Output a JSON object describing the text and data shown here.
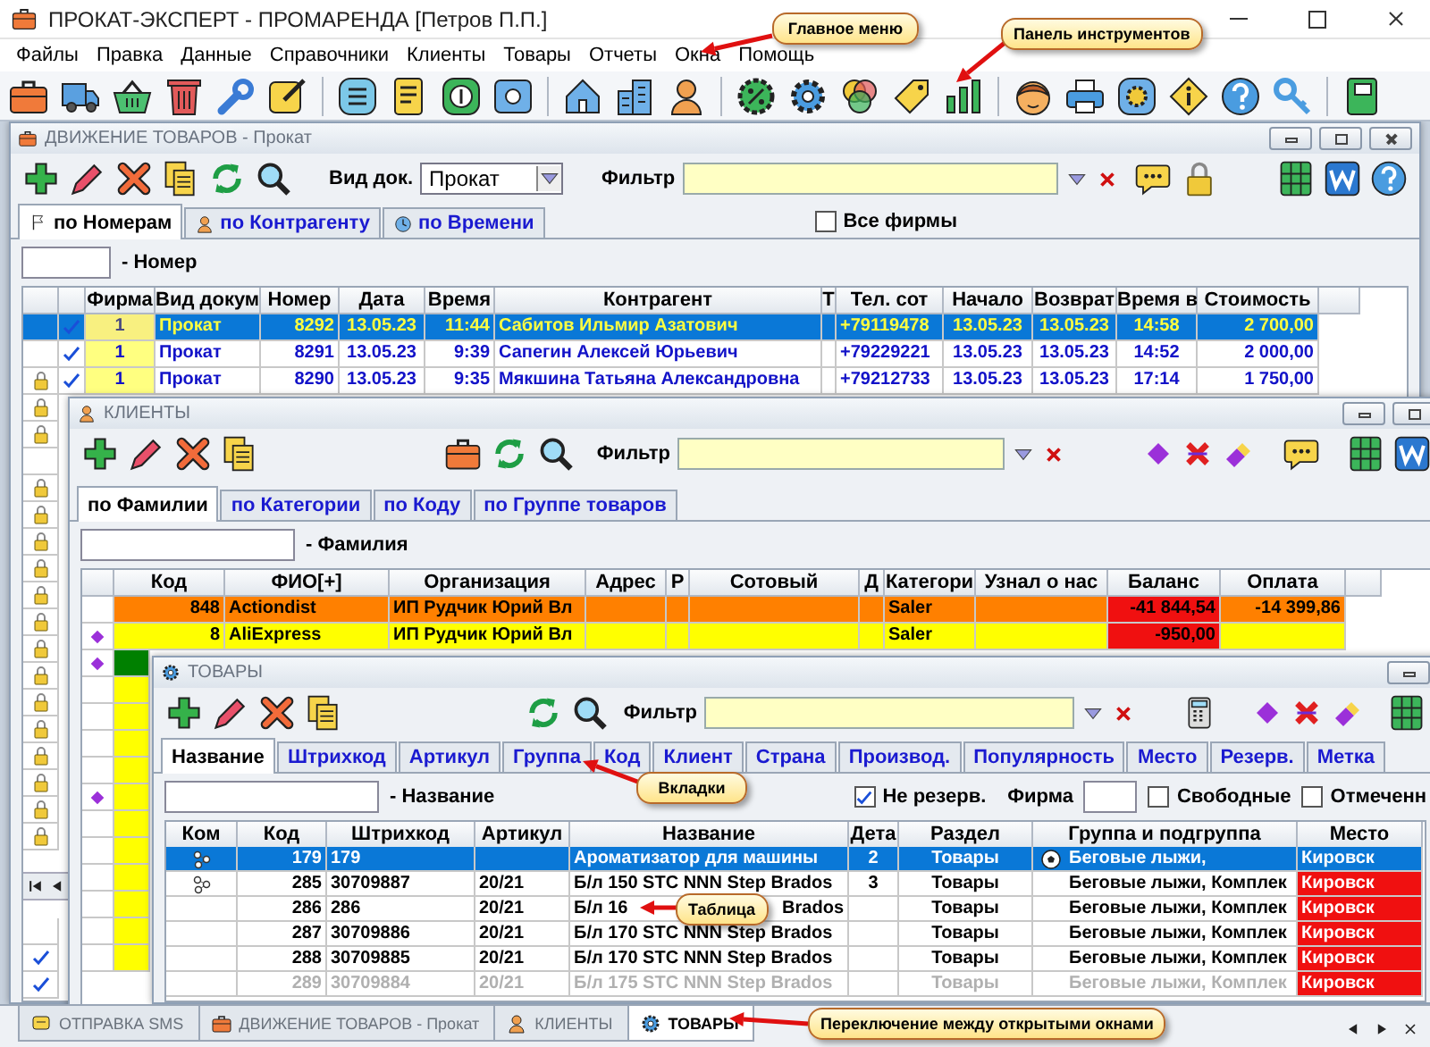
{
  "window": {
    "title": "ПРОКАТ-ЭКСПЕРТ - ПРОМАРЕНДА [Петров П.П.]"
  },
  "menu": [
    "Файлы",
    "Правка",
    "Данные",
    "Справочники",
    "Клиенты",
    "Товары",
    "Отчеты",
    "Окна",
    "Помощь"
  ],
  "movements": {
    "title": "ДВИЖЕНИЕ ТОВАРОВ - Прокат",
    "doc_type_label": "Вид док.",
    "doc_type": "Прокат",
    "filter_label": "Фильтр",
    "tabs": [
      {
        "label": "по Номерам",
        "selected": true
      },
      {
        "label": "по Контрагенту",
        "selected": false
      },
      {
        "label": "по Времени",
        "selected": false
      }
    ],
    "all_firms": {
      "label": "Все фирмы",
      "checked": false
    },
    "number_label": "- Номер",
    "columns": [
      "Фирма",
      "Вид докум",
      "Номер",
      "Дата",
      "Время",
      "Контрагент",
      "Т",
      "Тел. сот",
      "Начало",
      "Возврат",
      "Время в",
      "Стоимость"
    ],
    "rows": [
      {
        "selected": true,
        "locked": false,
        "checked": true,
        "firm": "1",
        "doc": "Прокат",
        "number": "8292",
        "date": "13.05.23",
        "time": "11:44",
        "party": "Сабитов Ильмир Азатович",
        "phone": "+79119478",
        "start": "13.05.23",
        "return": "13.05.23",
        "return_time": "14:58",
        "cost": "2 700,00"
      },
      {
        "selected": false,
        "locked": false,
        "checked": true,
        "firm": "1",
        "doc": "Прокат",
        "number": "8291",
        "date": "13.05.23",
        "time": "9:39",
        "party": "Сапегин Алексей Юрьевич",
        "phone": "+79229221",
        "start": "13.05.23",
        "return": "13.05.23",
        "return_time": "14:52",
        "cost": "2 000,00"
      },
      {
        "selected": false,
        "locked": true,
        "checked": true,
        "firm": "1",
        "doc": "Прокат",
        "number": "8290",
        "date": "13.05.23",
        "time": "9:35",
        "party": "Мякшина Татьяна Александровна",
        "phone": "+79212733",
        "start": "13.05.23",
        "return": "13.05.23",
        "return_time": "17:14",
        "cost": "1 750,00"
      },
      {
        "locked": true
      },
      {
        "locked": true
      },
      {
        "locked": false
      },
      {
        "locked": true
      },
      {
        "locked": true
      },
      {
        "locked": true
      },
      {
        "locked": true
      },
      {
        "locked": true
      },
      {
        "locked": true
      },
      {
        "locked": true
      },
      {
        "locked": true
      },
      {
        "locked": true
      },
      {
        "locked": true
      },
      {
        "locked": true
      },
      {
        "locked": true
      },
      {
        "locked": true
      },
      {
        "locked": true
      }
    ],
    "lower_rows": [
      {
        "checked": false
      },
      {
        "checked": true
      },
      {
        "checked": true
      }
    ]
  },
  "clients": {
    "title": "КЛИЕНТЫ",
    "filter_label": "Фильтр",
    "tabs": [
      {
        "label": "по Фамилии",
        "selected": true
      },
      {
        "label": "по Категории",
        "selected": false
      },
      {
        "label": "по Коду",
        "selected": false
      },
      {
        "label": "по Группе товаров",
        "selected": false
      }
    ],
    "search_label": "- Фамилия",
    "columns": [
      "Код",
      "ФИО[+]",
      "Организация",
      "Адрес",
      "Р",
      "Сотовый",
      "Д",
      "Категори",
      "Узнал о нас",
      "Баланс",
      "Оплата"
    ],
    "rows": [
      {
        "marked": false,
        "color": "#ff8000",
        "debt": true,
        "code": "848",
        "name": "Actiondist",
        "org": "ИП Рудчик Юрий Вл",
        "category": "Saler",
        "balance": "-41 844,54",
        "payment": "-14 399,86"
      },
      {
        "marked": true,
        "color": "#ffff00",
        "debt": true,
        "code": "8",
        "name": "AliExpress",
        "org": "ИП Рудчик Юрий Вл",
        "category": "Saler",
        "balance": "-950,00"
      },
      {
        "marked": true,
        "color": "#008000"
      },
      {
        "marked": false,
        "color": "#ffff00"
      },
      {
        "marked": false,
        "color": "#ffff00"
      },
      {
        "marked": false,
        "color": "#ffff00"
      },
      {
        "marked": false,
        "color": "#ffff00"
      },
      {
        "marked": true,
        "color": "#ffff00"
      },
      {
        "marked": false,
        "color": "#ffff00"
      },
      {
        "marked": false,
        "color": "#ffff00"
      },
      {
        "marked": false,
        "color": "#ffff00"
      },
      {
        "marked": false,
        "color": "#ffff00"
      },
      {
        "marked": false,
        "color": "#ffff00"
      },
      {
        "marked": false,
        "color": "#ffff00"
      }
    ]
  },
  "goods": {
    "title": "ТОВАРЫ",
    "filter_label": "Фильтр",
    "tabs": [
      {
        "label": "Название",
        "selected": true
      },
      {
        "label": "Штрихкод",
        "selected": false
      },
      {
        "label": "Артикул",
        "selected": false
      },
      {
        "label": "Группа",
        "selected": false
      },
      {
        "label": "Код",
        "selected": false
      },
      {
        "label": "Клиент",
        "selected": false
      },
      {
        "label": "Страна",
        "selected": false
      },
      {
        "label": "Производ.",
        "selected": false
      },
      {
        "label": "Популярность",
        "selected": false
      },
      {
        "label": "Место",
        "selected": false
      },
      {
        "label": "Резерв.",
        "selected": false
      },
      {
        "label": "Метка",
        "selected": false
      }
    ],
    "search_label": "- Название",
    "not_reserved": {
      "label": "Не резерв.",
      "checked": true
    },
    "firm_label": "Фирма",
    "free": {
      "label": "Свободные",
      "checked": false
    },
    "marked": {
      "label": "Отмеченн",
      "checked": false
    },
    "columns": [
      "Ком",
      "Код",
      "Штрихкод",
      "Артикул",
      "Название",
      "Дета",
      "Раздел",
      "Группа и подгруппа",
      "Место"
    ],
    "rows": [
      {
        "selected": true,
        "dimmed": false,
        "has_parts": true,
        "group_icon": true,
        "code": "179",
        "barcode": "179",
        "name": "Ароматизатор для машины",
        "qty": "2",
        "section": "Товары",
        "group": "Беговые лыжи,",
        "place": "Кировск"
      },
      {
        "selected": false,
        "dimmed": false,
        "has_parts": true,
        "group_icon": false,
        "code": "285",
        "barcode": "30709887",
        "article": "20/21",
        "name": "Б/л 150 STC NNN Step Brados",
        "qty": "3",
        "section": "Товары",
        "group": "Беговые лыжи, Комплек",
        "place": "Кировск"
      },
      {
        "selected": false,
        "dimmed": false,
        "has_parts": false,
        "group_icon": false,
        "code": "286",
        "barcode": "286",
        "article": "20/21",
        "name": "Б/л 16",
        "name_tail": "Brados",
        "section": "Товары",
        "group": "Беговые лыжи, Комплек",
        "place": "Кировск"
      },
      {
        "selected": false,
        "dimmed": false,
        "has_parts": false,
        "group_icon": false,
        "code": "287",
        "barcode": "30709886",
        "article": "20/21",
        "name": "Б/л 170 STC NNN Step Brados",
        "section": "Товары",
        "group": "Беговые лыжи, Комплек",
        "place": "Кировск"
      },
      {
        "selected": false,
        "dimmed": false,
        "has_parts": false,
        "group_icon": false,
        "code": "288",
        "barcode": "30709885",
        "article": "20/21",
        "name": "Б/л 170 STC NNN Step Brados",
        "section": "Товары",
        "group": "Беговые лыжи, Комплек",
        "place": "Кировск"
      },
      {
        "selected": false,
        "dimmed": true,
        "has_parts": false,
        "group_icon": false,
        "code": "289",
        "barcode": "30709884",
        "article": "20/21",
        "name": "Б/л 175 STC NNN Step Brados",
        "section": "Товары",
        "group": "Беговые лыжи, Комплек",
        "place": "Кировск"
      }
    ]
  },
  "window_tabs": [
    {
      "label": "ОТПРАВКА SMS",
      "selected": false
    },
    {
      "label": "ДВИЖЕНИЕ ТОВАРОВ - Прокат",
      "selected": false
    },
    {
      "label": "КЛИЕНТЫ",
      "selected": false
    },
    {
      "label": "ТОВАРЫ",
      "selected": true
    }
  ],
  "callouts": [
    {
      "text": "Главное меню"
    },
    {
      "text": "Панель инструментов"
    },
    {
      "text": "Вкладки"
    },
    {
      "text": "Таблица"
    },
    {
      "text": "Переключение между открытыми окнами"
    }
  ]
}
